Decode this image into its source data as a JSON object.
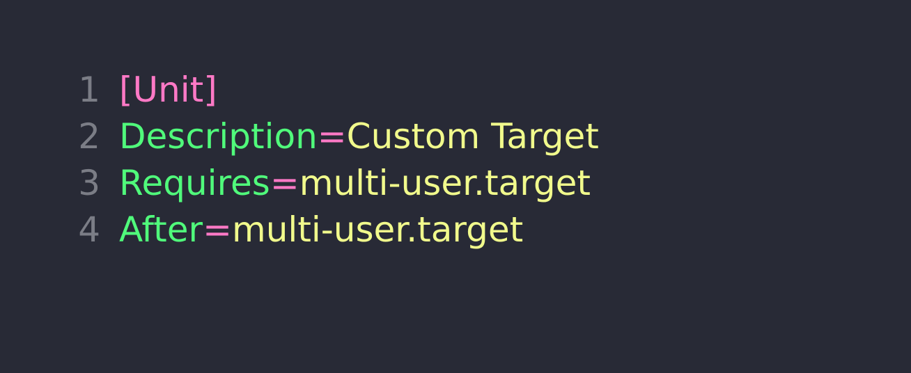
{
  "editor": {
    "lines": [
      {
        "number": "1",
        "section": "[Unit]"
      },
      {
        "number": "2",
        "key": "Description",
        "eq": "=",
        "value": "Custom Target"
      },
      {
        "number": "3",
        "key": "Requires",
        "eq": "=",
        "value": "multi-user.target"
      },
      {
        "number": "4",
        "key": "After",
        "eq": "=",
        "value": "multi-user.target"
      }
    ]
  },
  "colors": {
    "background": "#282a36",
    "line_number": "#7b7d86",
    "section": "#ff79c6",
    "key": "#50fa7b",
    "equals": "#ff79c6",
    "value": "#f1fa8c"
  }
}
